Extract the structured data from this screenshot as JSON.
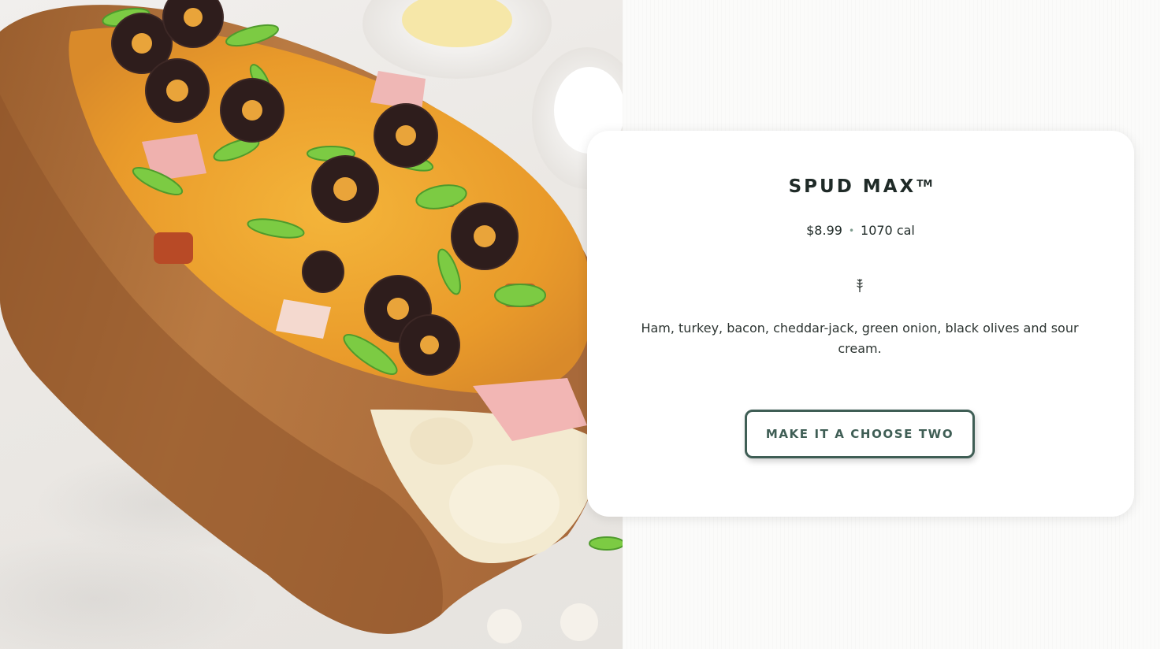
{
  "item": {
    "name": "SPUD MAX",
    "trademark": "TM",
    "price": "$8.99",
    "separator": "•",
    "calories": "1070 cal",
    "description": "Ham, turkey, bacon, cheddar-jack, green onion, black olives and sour cream.",
    "dietary_icon": "wheat-icon"
  },
  "actions": {
    "cta_label": "MAKE IT A CHOOSE TWO"
  },
  "colors": {
    "brand_green": "#3f5e55",
    "text_dark": "#1f2a27",
    "separator_dot": "#7c9a8c"
  }
}
